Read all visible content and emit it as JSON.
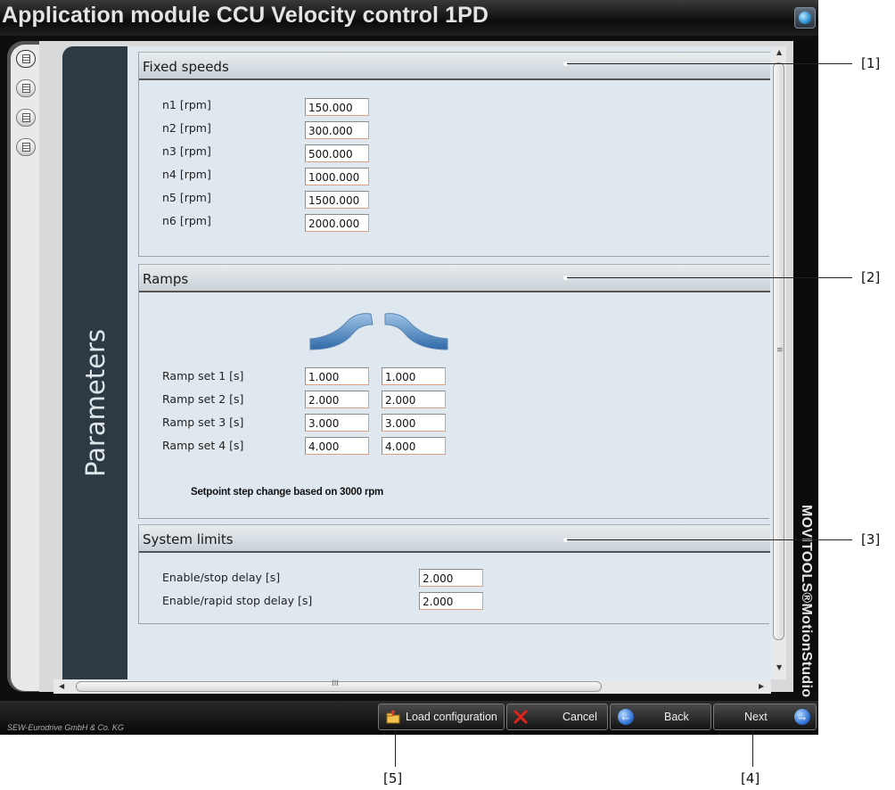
{
  "window": {
    "title": "Application module CCU Velocity control 1PD"
  },
  "sidebar": {
    "title": "Parameters",
    "tab_count": 4
  },
  "sections": {
    "fixed_speeds": {
      "title": "Fixed speeds",
      "rows": [
        {
          "label": "n1 [rpm]",
          "value": "150.000"
        },
        {
          "label": "n2 [rpm]",
          "value": "300.000"
        },
        {
          "label": "n3 [rpm]",
          "value": "500.000"
        },
        {
          "label": "n4 [rpm]",
          "value": "1000.000"
        },
        {
          "label": "n5 [rpm]",
          "value": "1500.000"
        },
        {
          "label": "n6 [rpm]",
          "value": "2000.000"
        }
      ]
    },
    "ramps": {
      "title": "Ramps",
      "rows": [
        {
          "label": "Ramp set 1  [s]",
          "up": "1.000",
          "down": "1.000"
        },
        {
          "label": "Ramp set 2  [s]",
          "up": "2.000",
          "down": "2.000"
        },
        {
          "label": "Ramp set 3  [s]",
          "up": "3.000",
          "down": "3.000"
        },
        {
          "label": "Ramp set 4  [s]",
          "up": "4.000",
          "down": "4.000"
        }
      ],
      "note": "Setpoint step change based on 3000 rpm"
    },
    "system_limits": {
      "title": "System limits",
      "rows": [
        {
          "label": "Enable/stop delay  [s]",
          "value": "2.000"
        },
        {
          "label": "Enable/rapid stop delay  [s]",
          "value": "2.000"
        }
      ]
    }
  },
  "brand": "MOVITOOLS®MotionStudio",
  "footer": {
    "company": "SEW-Eurodrive GmbH & Co. KG",
    "buttons": {
      "load": "Load configuration",
      "cancel": "Cancel",
      "back": "Back",
      "next": "Next"
    }
  },
  "scroll_glyphs": {
    "grip": "III",
    "grip_v": "≡",
    "up": "▲",
    "down": "▼",
    "left": "◀",
    "right": "▶"
  },
  "icons": {
    "globe": "globe-icon",
    "load": "folder-load-icon",
    "cancel": "cancel-x-icon",
    "back": "back-arrow-icon",
    "next": "next-arrow-icon"
  },
  "colors": {
    "panel": "#dfe8ee",
    "sidebar": "#2d3a43",
    "cancel_x": "#e0241c",
    "arrow_blue": "#2c6fd4"
  },
  "callouts": [
    "[1]",
    "[2]",
    "[3]",
    "[4]",
    "[5]"
  ]
}
